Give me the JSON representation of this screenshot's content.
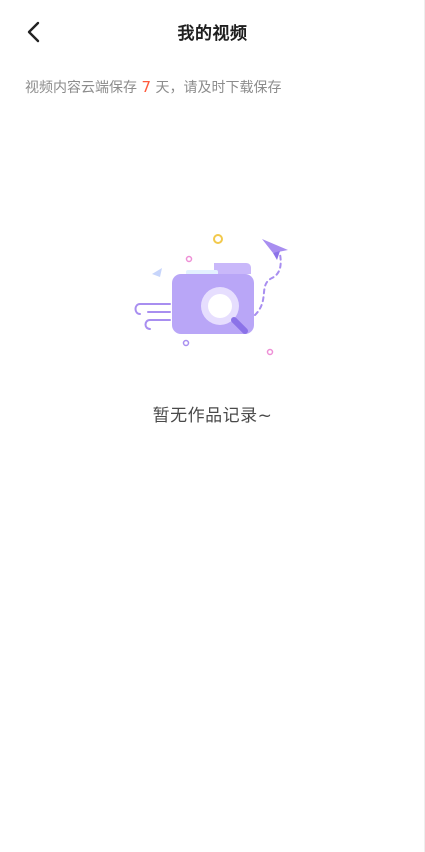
{
  "header": {
    "title": "我的视频",
    "back_icon": "chevron-left-icon"
  },
  "notice": {
    "prefix": "视频内容云端保存 ",
    "days": "7",
    "suffix": " 天，请及时下载保存",
    "accent_color": "#ff5a3c"
  },
  "empty_state": {
    "illustration_icon": "folder-search-icon",
    "message": "暂无作品记录~"
  },
  "colors": {
    "background": "#ffffff",
    "title": "#1f1f1f",
    "notice_text": "#8c8c8c",
    "illustration_primary": "#b9a6f7",
    "illustration_light": "#e6defe"
  }
}
